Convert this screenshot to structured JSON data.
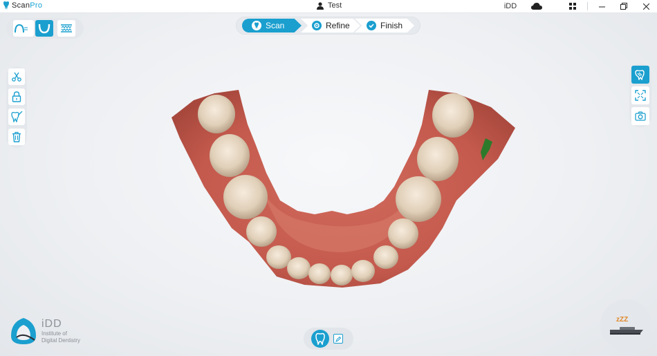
{
  "titlebar": {
    "app_logo_prefix": "Scan",
    "app_logo_suffix": "Pro",
    "user_name": "Test",
    "brand": "iDD"
  },
  "stepper": {
    "steps": [
      {
        "label": "Scan",
        "active": true
      },
      {
        "label": "Refine",
        "active": false
      },
      {
        "label": "Finish",
        "active": false
      }
    ]
  },
  "colors": {
    "accent": "#1a9fcf",
    "panel": "#e4e7eb"
  },
  "left_tools": [
    "scissors-icon",
    "lock-icon",
    "tooth-brush-icon",
    "trash-icon"
  ],
  "right_tools": [
    "tooth-view-icon",
    "fullscreen-icon",
    "camera-icon"
  ],
  "footer": {
    "brand_name": "iDD",
    "brand_line1": "Institute of",
    "brand_line2": "Digital Dentistry",
    "sleep_label": "zZZ"
  }
}
